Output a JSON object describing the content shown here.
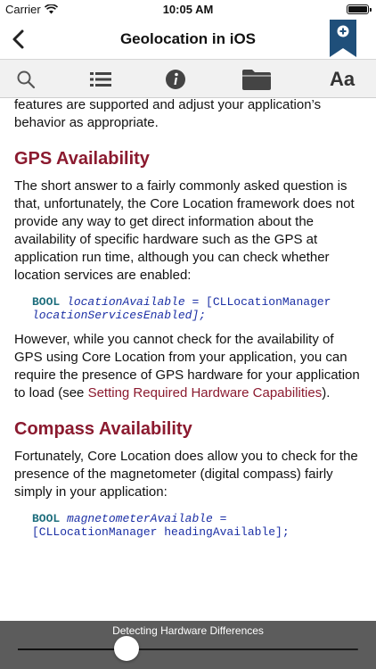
{
  "status_bar": {
    "carrier": "Carrier",
    "time": "10:05 AM"
  },
  "nav": {
    "title": "Geolocation in iOS"
  },
  "toolbar": {
    "font_label": "Aa"
  },
  "content": {
    "para_intro": "features are supported and adjust your application’s behavior as appropriate.",
    "heading_gps": "GPS Availability",
    "para_gps_1": "The short answer to a fairly commonly asked question is that, unfortunately, the Core Location framework does not provide any way to get direct information about the availability of specific hardware such as the GPS at application run time, although you can check whether location services are enabled:",
    "code_1": {
      "keyword": "BOOL",
      "var": "locationAvailable",
      "rest_1": " = [CLLocationManager",
      "line_2": "locationServicesEnabled];"
    },
    "para_gps_2": "However, while you cannot check for the availability of GPS using Core Location from your application, you can require the presence of GPS hardware for your application to load (see ",
    "link_text": "Setting Required Hardware Capabilities",
    "para_gps_2_end": ").",
    "heading_compass": "Compass Availability",
    "para_compass": "Fortunately, Core Location does allow you to check for the presence of the magnetometer (digital compass) fairly simply in your application:",
    "code_2": {
      "keyword": "BOOL",
      "var": "magnetometerAvailable",
      "rest_1": " =",
      "line_2": "[CLLocationManager headingAvailable];"
    }
  },
  "scrubber": {
    "label": "Detecting Hardware Differences",
    "progress": 0.32
  },
  "colors": {
    "heading": "#8b1a2f",
    "bookmark": "#1f4f7a",
    "code": "#1b2fa5"
  }
}
